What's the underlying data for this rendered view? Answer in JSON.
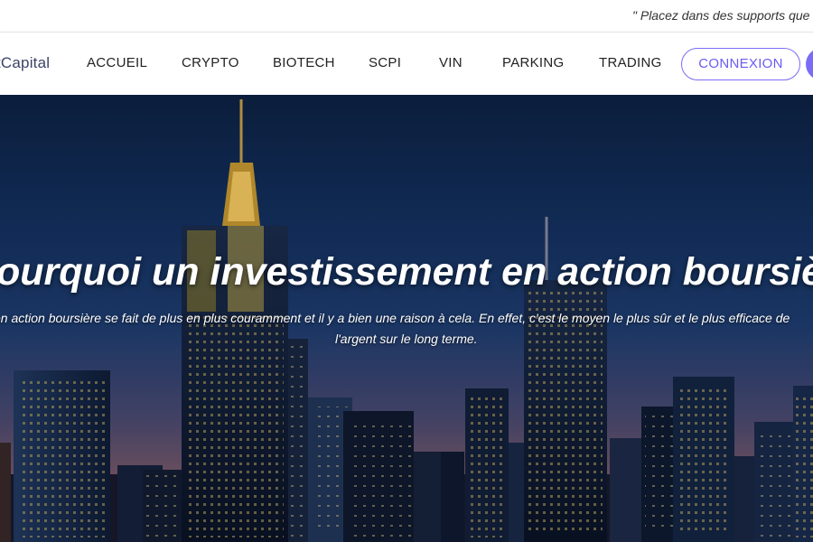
{
  "topbar": {
    "text": "\" Placez dans des supports que"
  },
  "header": {
    "logo": "tCapital",
    "nav": [
      {
        "label": "ACCUEIL"
      },
      {
        "label": "CRYPTO"
      },
      {
        "label": "BIOTECH"
      },
      {
        "label": "SCPI"
      },
      {
        "label": "VIN"
      },
      {
        "label": "PARKING"
      },
      {
        "label": "TRADING"
      }
    ],
    "login_label": "CONNEXION"
  },
  "hero": {
    "title": "ourquoi un investissement en action boursière",
    "subtitle_line1": "en action boursière se fait de plus en plus couramment et il y a bien une raison à cela. En effet, c'est le moyen le plus sûr et le plus efficace de",
    "subtitle_line2": "l'argent sur le long terme."
  },
  "colors": {
    "accent": "#7b6cf6",
    "nav_text": "#222222",
    "sky_top": "#0d2244",
    "sky_horizon": "#7a5a6a"
  }
}
